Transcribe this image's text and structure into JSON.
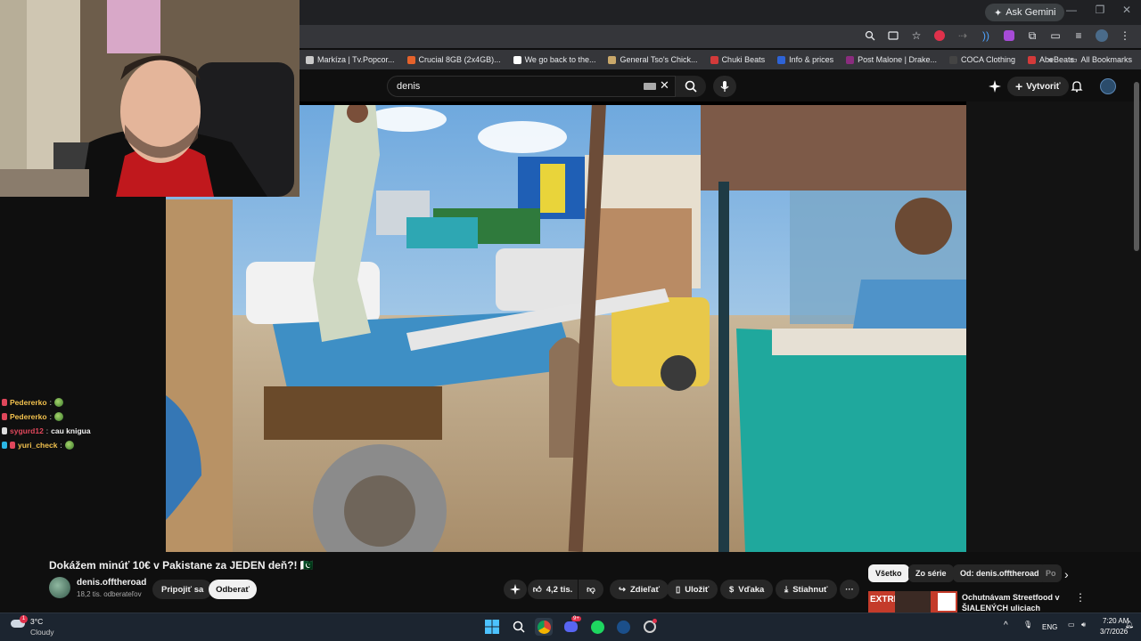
{
  "browser": {
    "ask_gemini": "Ask Gemini",
    "bookmarks": [
      {
        "label": "Markíza | Tv.Popcor...",
        "color": "#c9c9c9"
      },
      {
        "label": "Crucial 8GB (2x4GB)...",
        "color": "#e5622b"
      },
      {
        "label": "We go back to the...",
        "color": "#ffffff"
      },
      {
        "label": "General Tso's Chick...",
        "color": "#c9a86a"
      },
      {
        "label": "Chuki Beats",
        "color": "#d33a3a"
      },
      {
        "label": "Info & prices",
        "color": "#2e63d6"
      },
      {
        "label": "Post Malone | Drake...",
        "color": "#8a2c7e"
      },
      {
        "label": "COCA Clothing",
        "color": "#444444"
      },
      {
        "label": "AbeBeats",
        "color": "#d33a3a"
      }
    ],
    "bookmarks_more": "»",
    "all_bookmarks": "All Bookmarks"
  },
  "youtube": {
    "search_value": "denis",
    "create_label": "Vytvoriť",
    "video_title": "Dokážem minúť 10€ v Pakistane za JEDEN deň?! 🇵🇰",
    "channel_name": "denis.offtheroad",
    "subscribers": "18,2 tis. odberateľov",
    "join_label": "Pripojiť sa",
    "subscribe_label": "Odberať",
    "likes": "4,2 tis.",
    "share_label": "Zdieľať",
    "save_label": "Uložiť",
    "thanks_label": "Vďaka",
    "download_label": "Stiahnuť",
    "more_label": "···",
    "chips": [
      "Všetko",
      "Zo série",
      "Od: denis.offtheroad",
      "Po"
    ],
    "rec_title": "Ochutnávam Streetfood v ŠIALENÝCH uliciach Pakistan...",
    "rec_thumb_text": "EXTRÉM"
  },
  "chat": [
    {
      "user": "Pedererko",
      "sep": ":",
      "msg": "",
      "color": "#f2c14e",
      "badge": "#e0475b",
      "emote": true
    },
    {
      "user": "Pedererko",
      "sep": ":",
      "msg": "",
      "color": "#f2c14e",
      "badge": "#e0475b",
      "emote": true
    },
    {
      "user": "sygurd12",
      "sep": ":",
      "msg": "cau knigua",
      "color": "#e0475b",
      "badge": "#dddddd",
      "emote": false
    },
    {
      "user": "yuri_check",
      "sep": ":",
      "msg": "",
      "color": "#f2c14e",
      "badge": "#2ab5e3",
      "badge2": "#e0475b",
      "emote": true
    }
  ],
  "taskbar": {
    "temperature": "3°C",
    "weather": "Cloudy",
    "weather_badge": "1",
    "discord_badge": "9+",
    "language": "ENG",
    "time": "7:20 AM",
    "date": "3/7/2026"
  },
  "colors": {
    "bg": "#0f0f0f",
    "chrome_dark": "#202124",
    "chrome_toolbar": "#35363a",
    "taskbar": "#1c2530"
  }
}
